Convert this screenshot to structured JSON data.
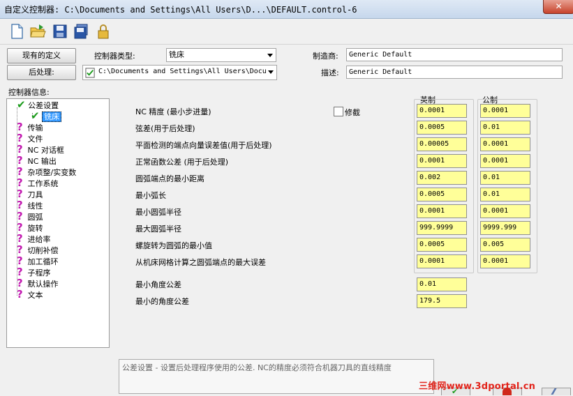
{
  "window": {
    "title": "自定义控制器: C:\\Documents and Settings\\All Users\\D...\\DEFAULT.control-6",
    "close_glyph": "✕"
  },
  "toolbar": {
    "icons": [
      "new-file-icon",
      "open-folder-icon",
      "save-icon",
      "save-as-icon",
      "lock-icon"
    ]
  },
  "top": {
    "existing_def_button": "现有的定义",
    "post_button": "后处理:",
    "controller_type_label": "控制器类型:",
    "controller_type_value": "铣床",
    "post_path": "C:\\Documents and Settings\\All Users\\Docu",
    "manufacturer_label": "制造商:",
    "manufacturer_value": "Generic Default",
    "description_label": "描述:",
    "description_value": "Generic Default"
  },
  "tree": {
    "header": "控制器信息:",
    "items": [
      {
        "label": "公差设置"
      },
      {
        "label": "铣床"
      },
      {
        "label": "传输"
      },
      {
        "label": "文件"
      },
      {
        "label": "NC 对话框"
      },
      {
        "label": "NC 输出"
      },
      {
        "label": "杂项整/实变数"
      },
      {
        "label": "工作系统"
      },
      {
        "label": "刀具"
      },
      {
        "label": "线性"
      },
      {
        "label": "圆弧"
      },
      {
        "label": "旋转"
      },
      {
        "label": "进给率"
      },
      {
        "label": "切削补偿"
      },
      {
        "label": "加工循环"
      },
      {
        "label": "子程序"
      },
      {
        "label": "默认操作"
      },
      {
        "label": "文本"
      }
    ]
  },
  "tolerances": {
    "inch_header": "英制",
    "metric_header": "公制",
    "modify_label": "修截",
    "rows": [
      {
        "label": "NC 精度 (最小步进量)",
        "inch": "0.0001",
        "metric": "0.0001"
      },
      {
        "label": "弦差(用于后处理)",
        "inch": "0.0005",
        "metric": "0.01"
      },
      {
        "label": "平面检测的端点向量误差值(用于后处理)",
        "inch": "0.00005",
        "metric": "0.0001"
      },
      {
        "label": "正常函数公差  (用于后处理)",
        "inch": "0.0001",
        "metric": "0.0001"
      },
      {
        "label": "圆弧端点的最小距离",
        "inch": "0.002",
        "metric": "0.01"
      },
      {
        "label": "最小弧长",
        "inch": "0.0005",
        "metric": "0.01"
      },
      {
        "label": "最小圆弧半径",
        "inch": "0.0001",
        "metric": "0.0001"
      },
      {
        "label": "最大圆弧半径",
        "inch": "999.9999",
        "metric": "9999.999"
      },
      {
        "label": "螺旋转为圆弧的最小值",
        "inch": "0.0005",
        "metric": "0.005"
      },
      {
        "label": "从机床网格计算之圆弧端点的最大误差",
        "inch": "0.0001",
        "metric": "0.0001"
      }
    ],
    "angle_rows": [
      {
        "label": "最小角度公差",
        "value": "0.01"
      },
      {
        "label": "最小的角度公差",
        "value": "179.5"
      }
    ]
  },
  "status_text": "公差设置 - 设置后处理程序使用的公差. NC的精度必须符合机器刀具的直线精度",
  "watermark": "三维网www.3dportal.cn"
}
